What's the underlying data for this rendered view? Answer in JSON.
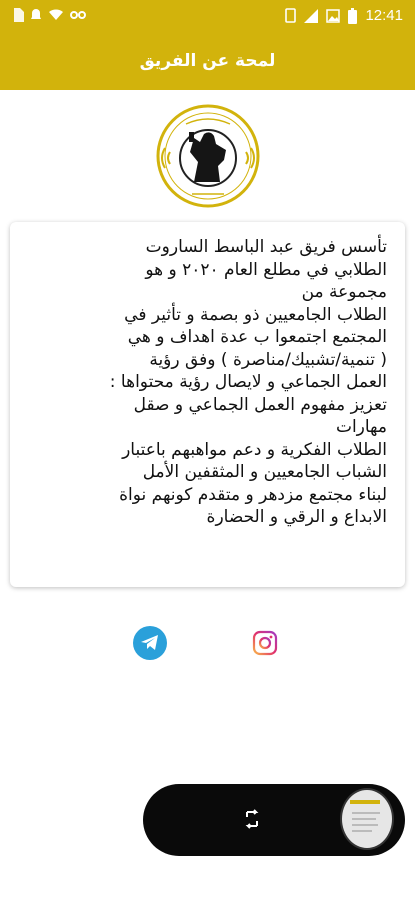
{
  "status_bar": {
    "time": "12:41"
  },
  "app_bar": {
    "title": "لمحة عن الفريق"
  },
  "about": {
    "lines": [
      "تأسس فريق عبد الباسط الساروت",
      "الطلابي في مطلع العام ٢٠٢٠ و هو",
      "مجموعة من",
      "الطلاب الجامعيين ذو بصمة و تأثير في",
      "المجتمع اجتمعوا ب عدة اهداف و هي",
      "( تنمية/تشبيك/مناصرة ) وفق رؤية",
      "العمل الجماعي و لايصال رؤية محتواها :",
      "تعزيز مفهوم العمل الجماعي و صقل",
      "مهارات",
      "الطلاب الفكرية و دعم مواهبهم باعتبار",
      "الشباب الجامعيين و المثقفين الأمل",
      "لبناء مجتمع مزدهر و متقدم كونهم نواة",
      "الابداع و الرقي و الحضارة"
    ]
  },
  "social": {
    "telegram_icon": "telegram-icon",
    "instagram_icon": "instagram-icon"
  },
  "colors": {
    "brand": "#d2b30c",
    "telegram": "#2aa0da",
    "instagram": "#e1306c"
  }
}
